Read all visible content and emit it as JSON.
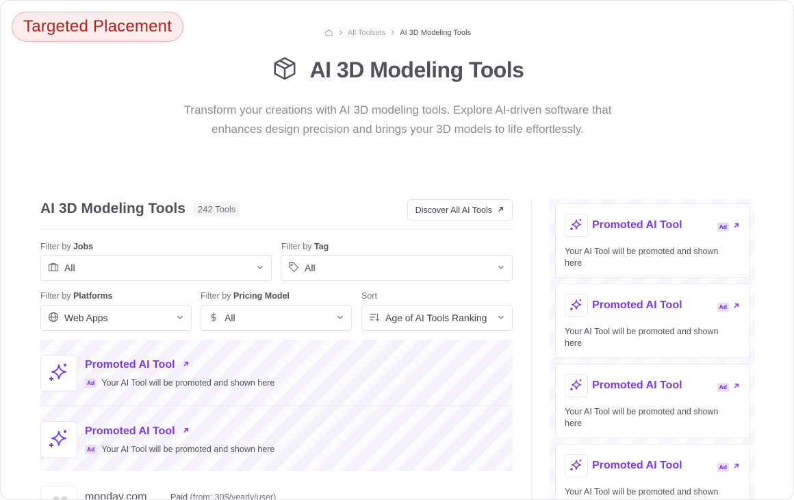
{
  "placement_badge": "Targeted Placement",
  "breadcrumb": {
    "home_icon": "home-icon",
    "items": [
      "All Toolsets",
      "AI 3D Modeling Tools"
    ]
  },
  "hero": {
    "icon": "cube-icon",
    "title": "AI 3D Modeling Tools",
    "description": "Transform your creations with AI 3D modeling tools. Explore AI-driven software that enhances design precision and brings your 3D models to life effortlessly."
  },
  "list": {
    "title": "AI 3D Modeling Tools",
    "count": "242 Tools",
    "discover_label": "Discover All AI Tools"
  },
  "filters": {
    "jobs": {
      "prefix": "Filter by",
      "label": "Jobs",
      "value": "All",
      "icon": "briefcase-icon"
    },
    "tag": {
      "prefix": "Filter by",
      "label": "Tag",
      "value": "All",
      "icon": "tag-icon"
    },
    "platforms": {
      "prefix": "Filter by",
      "label": "Platforms",
      "value": "Web Apps",
      "icon": "globe-icon"
    },
    "pricing": {
      "prefix": "Filter by",
      "label": "Pricing Model",
      "value": "All",
      "icon": "dollar-icon"
    },
    "sort": {
      "label": "Sort",
      "value": "Age of AI Tools Ranking",
      "icon": "sort-icon"
    }
  },
  "promoted_rows": [
    {
      "name": "Promoted AI Tool",
      "ad": "Ad",
      "text": "Your AI Tool will be promoted and shown here"
    },
    {
      "name": "Promoted AI Tool",
      "ad": "Ad",
      "text": "Your AI Tool will be promoted and shown here"
    }
  ],
  "listing": {
    "name": "monday.com",
    "price_label": "Paid",
    "price_detail": "(from: 30$/yearly/user)"
  },
  "side_cards": [
    {
      "name": "Promoted AI Tool",
      "ad": "Ad",
      "text": "Your AI Tool will be promoted and shown here"
    },
    {
      "name": "Promoted AI Tool",
      "ad": "Ad",
      "text": "Your AI Tool will be promoted and shown here"
    },
    {
      "name": "Promoted AI Tool",
      "ad": "Ad",
      "text": "Your AI Tool will be promoted and shown here"
    },
    {
      "name": "Promoted AI Tool",
      "ad": "Ad",
      "text": "Your AI Tool will be promoted and shown here"
    }
  ],
  "colors": {
    "accent": "#7c3aed",
    "badge_text": "#b42318",
    "badge_bg": "#fdecec"
  }
}
